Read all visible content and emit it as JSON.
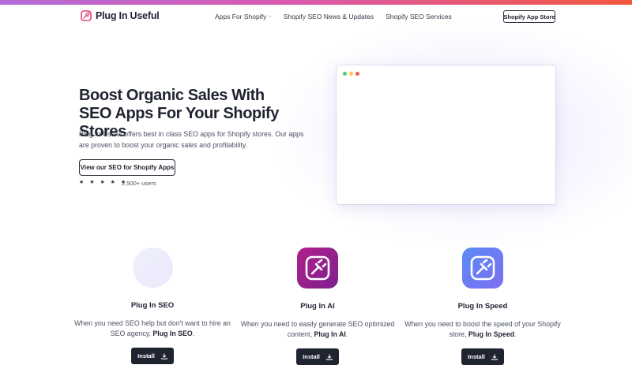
{
  "brand": {
    "name": "Plug In Useful",
    "accent": "#e0467a"
  },
  "nav": {
    "items": [
      {
        "label": "Apps For Shopify",
        "has_dropdown": true
      },
      {
        "label": "Shopify SEO News & Updates"
      },
      {
        "label": "Shopify SEO Services"
      }
    ],
    "cta_label": "Shopify App Store"
  },
  "hero": {
    "title": "Boost Organic Sales With SEO Apps For Your Shopify Stores",
    "description": "Plug In Useful offers best in class SEO apps for Shopify stores. Our apps are proven to boost your organic sales and profitability.",
    "cta_label": "View our SEO for Shopify Apps",
    "rating": {
      "stars": 5,
      "display": "★ ★ ★ ★ ★"
    },
    "users": "2,500+ users"
  },
  "browser_mock": {
    "dot_colors": [
      "#4ccf6b",
      "#f2c94c",
      "#ef5a5a"
    ]
  },
  "apps": [
    {
      "name": "Plug In SEO",
      "desc_prefix": "When you need SEO help but don't want to hire an SEO agency,",
      "desc_bold": "Plug In SEO",
      "desc_suffix": ".",
      "install_label": "Install",
      "icon": "plug-in-seo-icon"
    },
    {
      "name": "Plug In AI",
      "desc_prefix": "When you need to easily generate SEO optimized content,",
      "desc_bold": "Plug In AI",
      "desc_suffix": ".",
      "install_label": "Install",
      "icon": "plug-in-ai-icon"
    },
    {
      "name": "Plug In Speed",
      "desc_prefix": "When you need to boost the speed of your Shopify store,",
      "desc_bold": "Plug In Speed",
      "desc_suffix": ".",
      "install_label": "Install",
      "icon": "plug-in-speed-icon"
    }
  ]
}
